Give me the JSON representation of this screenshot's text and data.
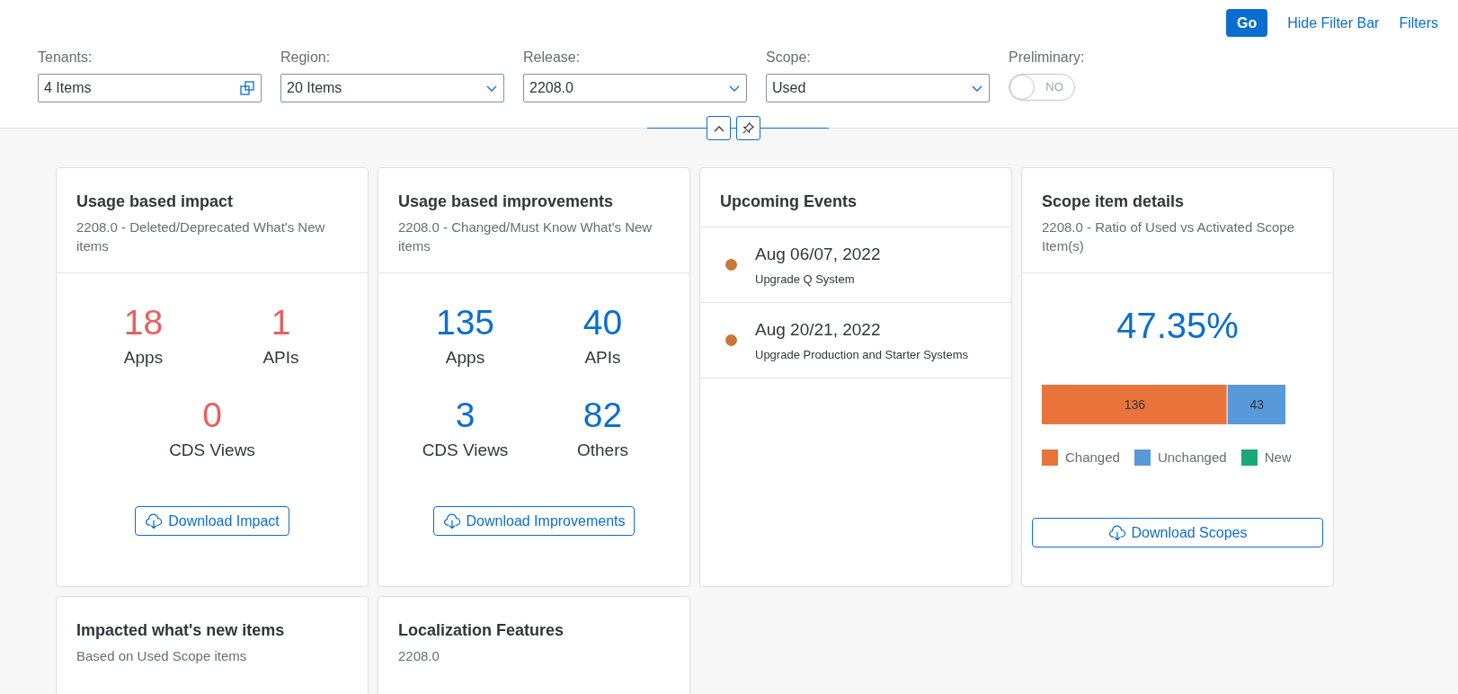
{
  "toolbar": {
    "go": "Go",
    "hide_filter_bar": "Hide Filter Bar",
    "filters": "Filters"
  },
  "filters": [
    {
      "kind": "multi",
      "label": "Tenants:",
      "value": "4 Items"
    },
    {
      "kind": "select",
      "label": "Region:",
      "value": "20 Items"
    },
    {
      "kind": "select",
      "label": "Release:",
      "value": "2208.0"
    },
    {
      "kind": "select",
      "label": "Scope:",
      "value": "Used"
    },
    {
      "kind": "switch",
      "label": "Preliminary:",
      "on": false,
      "text": "NO"
    }
  ],
  "cards": [
    {
      "kind": "metrics",
      "title": "Usage based impact",
      "subtitle": "2208.0 - Deleted/Deprecated What's New items",
      "color": "#e9605f",
      "metrics": [
        {
          "value": "18",
          "label": "Apps"
        },
        {
          "value": "1",
          "label": "APIs"
        },
        {
          "value": "0",
          "label": "CDS Views"
        }
      ],
      "button": "Download Impact"
    },
    {
      "kind": "metrics",
      "title": "Usage based improvements",
      "subtitle": "2208.0 - Changed/Must Know What's New items",
      "color": "#0a6ed1",
      "metrics": [
        {
          "value": "135",
          "label": "Apps"
        },
        {
          "value": "40",
          "label": "APIs"
        },
        {
          "value": "3",
          "label": "CDS Views"
        },
        {
          "value": "82",
          "label": "Others"
        }
      ],
      "button": "Download Improvements"
    },
    {
      "kind": "events",
      "title": "Upcoming Events",
      "events": [
        {
          "date": "Aug 06/07, 2022",
          "text": "Upgrade Q System",
          "color": "#c8773a"
        },
        {
          "date": "Aug 20/21, 2022",
          "text": "Upgrade Production and Starter Systems",
          "color": "#c8773a"
        }
      ]
    },
    {
      "kind": "scope",
      "title": "Scope item details",
      "subtitle": "2208.0 - Ratio of Used vs Activated Scope Item(s)",
      "percent": "47.35%",
      "chart_data": {
        "type": "bar",
        "orientation": "horizontal",
        "stacked": true,
        "data_labels": true,
        "legend": "bottom",
        "series": [
          {
            "name": "Changed",
            "color": "#e8743b",
            "values": [
              136
            ]
          },
          {
            "name": "Unchanged",
            "color": "#5899da",
            "values": [
              43
            ]
          },
          {
            "name": "New",
            "color": "#19a979",
            "values": [
              null
            ]
          }
        ]
      },
      "button": "Download Scopes"
    },
    {
      "kind": "header",
      "title": "Impacted what's new items",
      "subtitle": "Based on Used Scope items"
    },
    {
      "kind": "header",
      "title": "Localization Features",
      "subtitle": "2208.0"
    }
  ]
}
